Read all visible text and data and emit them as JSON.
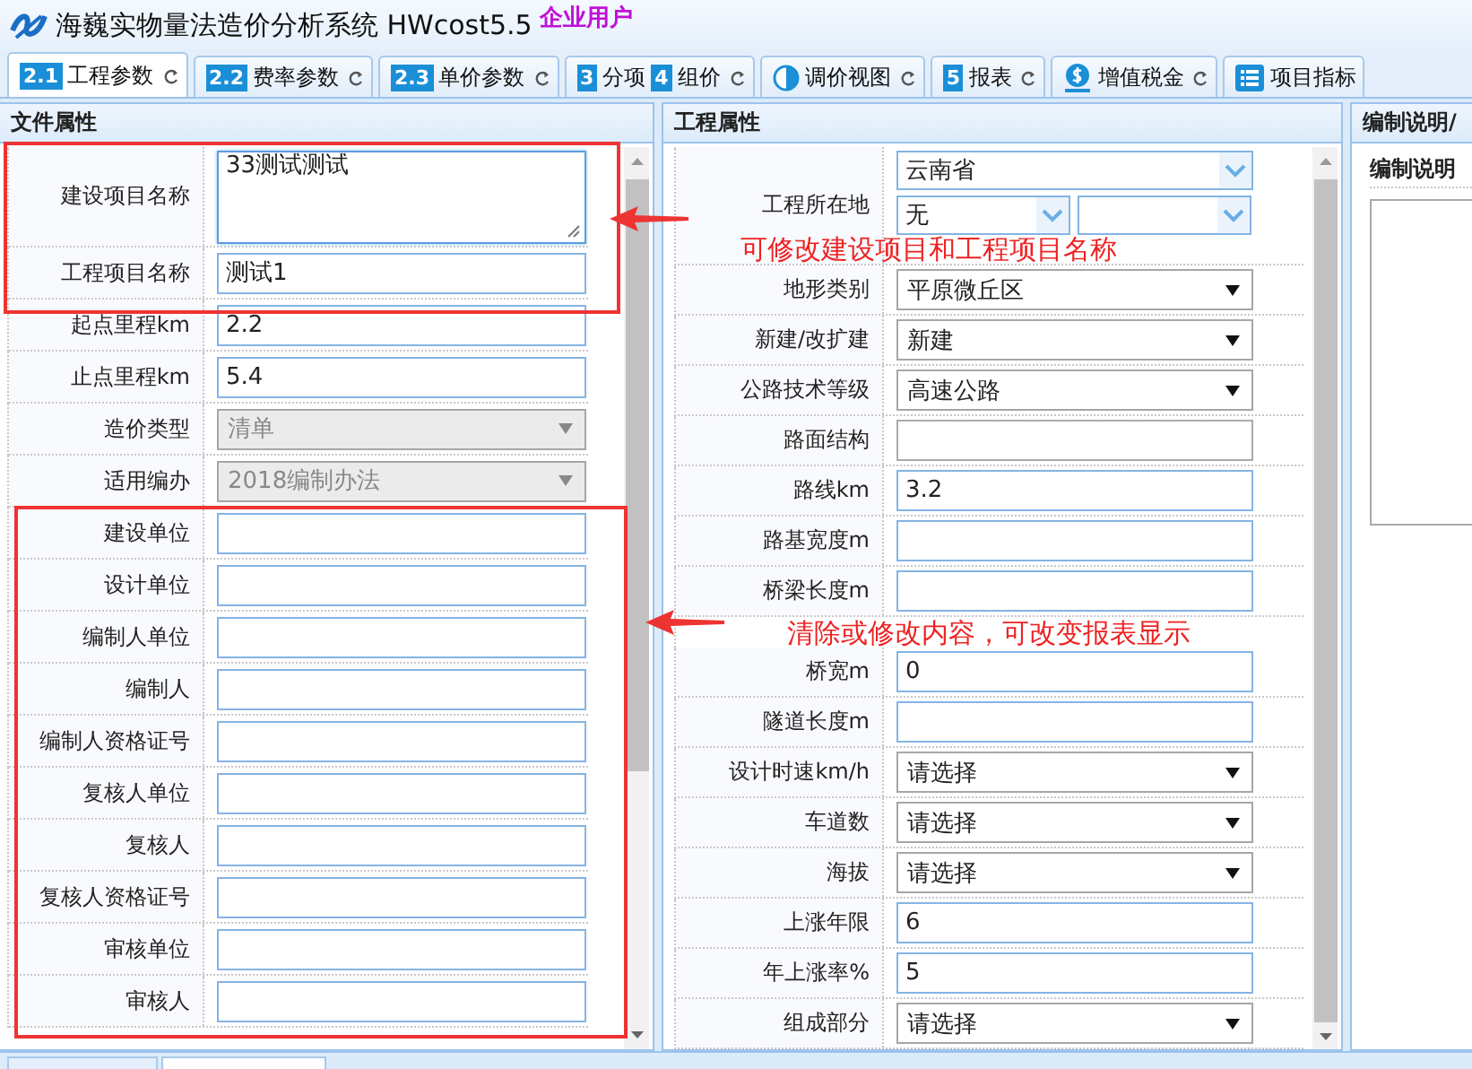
{
  "window": {
    "title": "海巍实物量法造价分析系统 HWcost5.5",
    "edition": "企业用户"
  },
  "tabs": [
    {
      "selected": true,
      "parts": [
        {
          "kind": "badge",
          "text": "2.1"
        },
        {
          "kind": "label",
          "text": "工程参数"
        }
      ]
    },
    {
      "selected": false,
      "parts": [
        {
          "kind": "badge",
          "text": "2.2"
        },
        {
          "kind": "label",
          "text": "费率参数"
        }
      ]
    },
    {
      "selected": false,
      "parts": [
        {
          "kind": "badge",
          "text": "2.3"
        },
        {
          "kind": "label",
          "text": "单价参数"
        }
      ]
    },
    {
      "selected": false,
      "parts": [
        {
          "kind": "badge",
          "text": "3"
        },
        {
          "kind": "label",
          "text": "分项"
        },
        {
          "kind": "badge",
          "text": "4"
        },
        {
          "kind": "label",
          "text": "组价"
        }
      ]
    },
    {
      "selected": false,
      "parts": [
        {
          "kind": "halfcircle"
        },
        {
          "kind": "label",
          "text": "调价视图"
        }
      ]
    },
    {
      "selected": false,
      "parts": [
        {
          "kind": "badge",
          "text": "5"
        },
        {
          "kind": "label",
          "text": "报表"
        }
      ]
    },
    {
      "selected": false,
      "parts": [
        {
          "kind": "coin"
        },
        {
          "kind": "label",
          "text": "增值税金"
        }
      ]
    },
    {
      "selected": false,
      "parts": [
        {
          "kind": "list"
        },
        {
          "kind": "label",
          "text": "项目指标"
        }
      ]
    }
  ],
  "file_panel": {
    "title": "文件属性",
    "rows": [
      {
        "label": "建设项目名称",
        "kind": "textarea",
        "value": "33测试测试"
      },
      {
        "label": "工程项目名称",
        "kind": "text",
        "value": "测试1"
      },
      {
        "label": "起点里程km",
        "kind": "text",
        "value": "2.2"
      },
      {
        "label": "止点里程km",
        "kind": "text",
        "value": "5.4"
      },
      {
        "label": "造价类型",
        "kind": "select",
        "value": "清单",
        "disabled": true
      },
      {
        "label": "适用编办",
        "kind": "select",
        "value": "2018编制办法",
        "disabled": true
      },
      {
        "label": "建设单位",
        "kind": "text"
      },
      {
        "label": "设计单位",
        "kind": "text"
      },
      {
        "label": "编制人单位",
        "kind": "text"
      },
      {
        "label": "编制人",
        "kind": "text"
      },
      {
        "label": "编制人资格证号",
        "kind": "text"
      },
      {
        "label": "复核人单位",
        "kind": "text"
      },
      {
        "label": "复核人",
        "kind": "text"
      },
      {
        "label": "复核人资格证号",
        "kind": "text"
      },
      {
        "label": "审核单位",
        "kind": "text"
      },
      {
        "label": "审核人",
        "kind": "text"
      }
    ]
  },
  "project_panel": {
    "title": "工程属性",
    "rows": [
      {
        "label": "工程所在地",
        "kind": "location",
        "selects": [
          {
            "value": "云南省"
          },
          {
            "value": "无"
          },
          {
            "kind": "empty"
          }
        ]
      },
      {
        "label": "地形类别",
        "kind": "select",
        "value": "平原微丘区",
        "disabled": false
      },
      {
        "label": "新建/改扩建",
        "kind": "select",
        "value": "新建",
        "disabled": false
      },
      {
        "label": "公路技术等级",
        "kind": "select",
        "value": "高速公路",
        "disabled": false
      },
      {
        "label": "路面结构",
        "kind": "plain"
      },
      {
        "label": "路线km",
        "kind": "text",
        "value": "3.2"
      },
      {
        "label": "路基宽度m",
        "kind": "text"
      },
      {
        "label": "桥梁长度m",
        "kind": "text"
      },
      {
        "label": "桥宽m",
        "kind": "text",
        "value": "0"
      },
      {
        "label": "隧道长度m",
        "kind": "text"
      },
      {
        "label": "设计时速km/h",
        "kind": "select",
        "value": "请选择",
        "disabled": false
      },
      {
        "label": "车道数",
        "kind": "select",
        "value": "请选择",
        "disabled": false
      },
      {
        "label": "海拔",
        "kind": "select",
        "value": "请选择",
        "disabled": false
      },
      {
        "label": "上涨年限",
        "kind": "text",
        "value": "6"
      },
      {
        "label": "年上涨率%",
        "kind": "text",
        "value": "5"
      },
      {
        "label": "组成部分",
        "kind": "select",
        "value": "请选择",
        "disabled": false
      }
    ]
  },
  "notes_panel": {
    "title": "编制说明/",
    "label": "编制说明"
  },
  "annotations": [
    {
      "text": "可修改建设项目和工程项目名称"
    },
    {
      "text": "清除或修改内容，可改变报表显示"
    }
  ]
}
